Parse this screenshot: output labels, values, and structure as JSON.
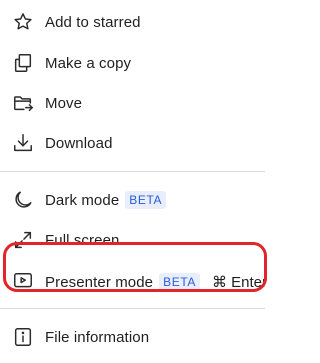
{
  "menu": {
    "items": [
      {
        "label": "Add to starred",
        "icon": "star-icon"
      },
      {
        "label": "Make a copy",
        "icon": "copy-icon"
      },
      {
        "label": "Move",
        "icon": "folder-move-icon"
      },
      {
        "label": "Download",
        "icon": "download-icon"
      },
      {
        "label": "Dark mode",
        "icon": "moon-icon",
        "badge": "BETA"
      },
      {
        "label": "Full screen",
        "icon": "expand-icon"
      },
      {
        "label": "Presenter mode",
        "icon": "presenter-icon",
        "badge": "BETA",
        "shortcut": "⌘ Enter"
      },
      {
        "label": "File information",
        "icon": "info-icon"
      }
    ]
  },
  "colors": {
    "badge_text": "#2a5bd7",
    "badge_bg": "#e8eefc",
    "highlight": "#e3242b"
  }
}
